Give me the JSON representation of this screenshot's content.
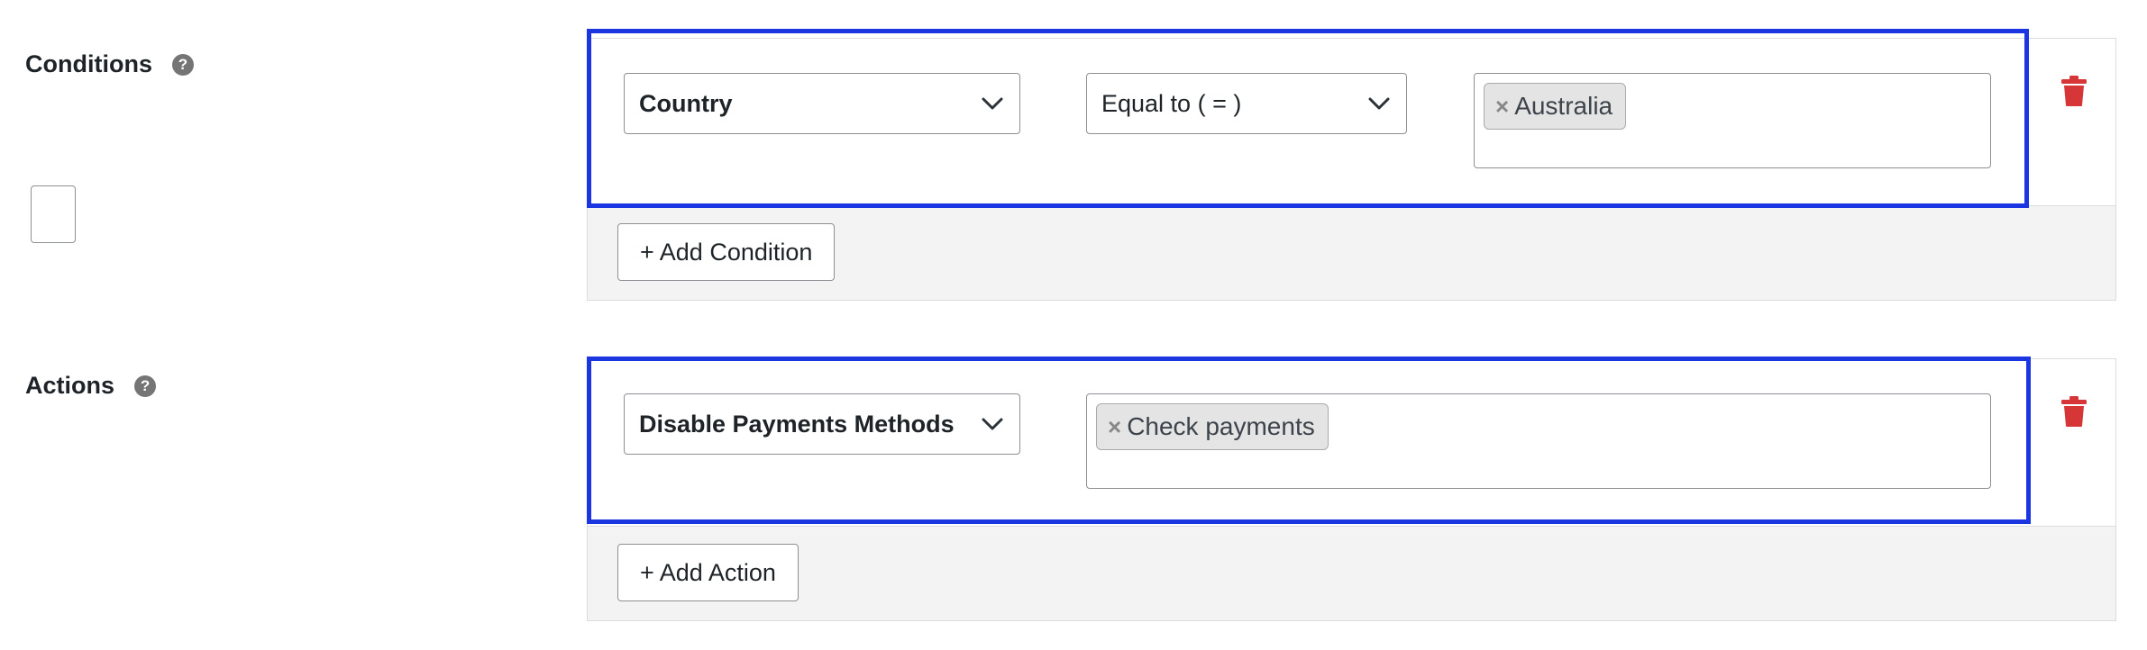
{
  "conditions": {
    "label": "Conditions",
    "help_glyph": "?",
    "field_select": "Country",
    "operator_select": "Equal to ( = )",
    "tags": [
      {
        "remove": "×",
        "text": "Australia"
      }
    ],
    "add_button": "+ Add Condition"
  },
  "actions": {
    "label": "Actions",
    "help_glyph": "?",
    "action_select": "Disable Payments Methods",
    "tags": [
      {
        "remove": "×",
        "text": "Check payments"
      }
    ],
    "add_button": "+ Add Action"
  },
  "colors": {
    "highlight": "#1b35e0",
    "trash": "#d63638",
    "panel_footer": "#f3f3f3"
  },
  "icons": {
    "help": "help-icon",
    "chevron": "chevron-down-icon",
    "delete": "trash-icon"
  }
}
